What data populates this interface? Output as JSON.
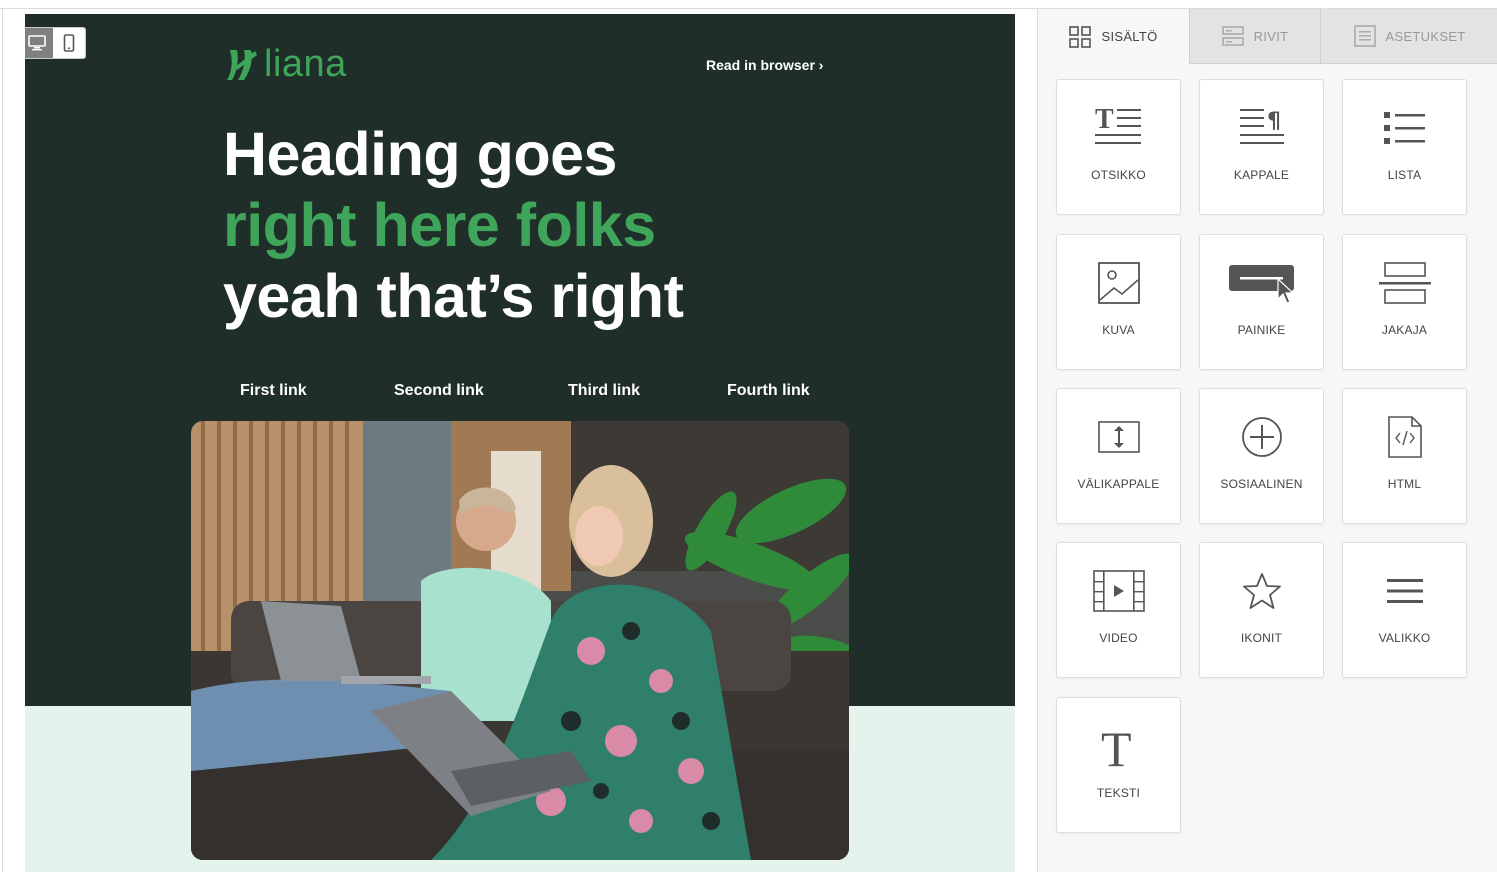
{
  "device_toggle": {
    "desktop_icon": "desktop-icon",
    "mobile_icon": "mobile-icon",
    "active": "desktop"
  },
  "email": {
    "logo_text": "liana",
    "read_in_browser": "Read in browser ›",
    "heading_line1": "Heading goes",
    "heading_line2": "right here folks",
    "heading_line3": "yeah that’s right",
    "nav_links": [
      "First link",
      "Second link",
      "Third link",
      "Fourth link"
    ],
    "colors": {
      "dark_bg": "#202e29",
      "accent_green": "#3fa55b",
      "light_bg": "#e4f3ec"
    }
  },
  "panel": {
    "tabs": [
      {
        "label": "SISÄLTÖ",
        "icon": "grid-icon",
        "active": true
      },
      {
        "label": "RIVIT",
        "icon": "rows-icon",
        "active": false
      },
      {
        "label": "ASETUKSET",
        "icon": "settings-doc-icon",
        "active": false
      }
    ],
    "blocks": [
      {
        "label": "OTSIKKO",
        "icon": "heading-icon"
      },
      {
        "label": "KAPPALE",
        "icon": "paragraph-icon"
      },
      {
        "label": "LISTA",
        "icon": "list-icon"
      },
      {
        "label": "KUVA",
        "icon": "image-icon"
      },
      {
        "label": "PAINIKE",
        "icon": "button-icon"
      },
      {
        "label": "JAKAJA",
        "icon": "divider-icon"
      },
      {
        "label": "VÄLIKAPPALE",
        "icon": "spacer-icon"
      },
      {
        "label": "SOSIAALINEN",
        "icon": "social-plus-icon"
      },
      {
        "label": "HTML",
        "icon": "html-file-icon"
      },
      {
        "label": "VIDEO",
        "icon": "video-icon"
      },
      {
        "label": "IKONIT",
        "icon": "star-icon"
      },
      {
        "label": "VALIKKO",
        "icon": "menu-icon"
      },
      {
        "label": "TEKSTI",
        "icon": "text-icon"
      }
    ]
  }
}
